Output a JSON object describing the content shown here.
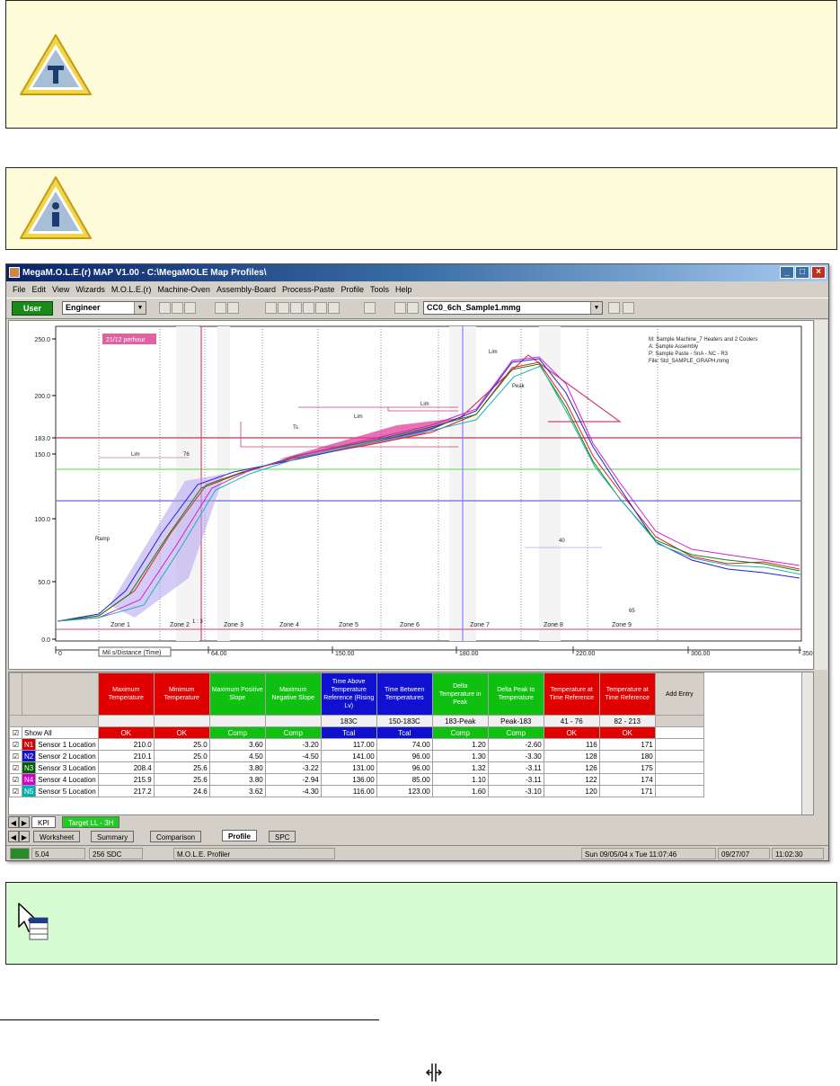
{
  "window": {
    "title": "MegaM.O.L.E.(r) MAP V1.00 - C:\\MegaMOLE Map Profiles\\",
    "menu": [
      "File",
      "Edit",
      "View",
      "Wizards",
      "M.O.L.E.(r)",
      "Machine-Oven",
      "Assembly-Board",
      "Process-Paste",
      "Profile",
      "Tools",
      "Help"
    ]
  },
  "toolbar": {
    "user_button": "User",
    "user_select": "Engineer",
    "profile_select": "CC0_6ch_Sample1.mmg"
  },
  "chart": {
    "badge": "21/12 perhour",
    "info_lines": [
      "M: Sample Machine_7 Heaters and 2 Coolers",
      "A: Sample Assembly",
      "P: Sample Paste - SnA - NC - R3",
      "File: Std_SAMPLE_GRAPH.mmg"
    ],
    "y_ticks": [
      "250.0",
      "200.0",
      "183.0",
      "150.0",
      "100.0",
      "50.0",
      "0.0"
    ],
    "x_axis_label": "Mil s/Distance (Time)",
    "x_ticks": [
      "0",
      "64.00",
      "150.00",
      "180.00",
      "220.00",
      "300.00",
      "350"
    ],
    "zones": [
      "Zone 1",
      "Zone 2",
      "Zone 3",
      "Zone 4",
      "Zone 5",
      "Zone 6",
      "Zone 7",
      "Zone 8",
      "Zone 9"
    ],
    "annotations": [
      "Ramp",
      "1 : 3",
      "Lim",
      "76",
      "Ts",
      "Lim",
      "Lim",
      "Lim",
      "Peak",
      "40",
      "65"
    ]
  },
  "grid": {
    "headers": [
      {
        "label": "Maximum Temperature",
        "color": "#e00000"
      },
      {
        "label": "Minimum Temperature",
        "color": "#e00000"
      },
      {
        "label": "Maximum Positive Slope",
        "color": "#10c010"
      },
      {
        "label": "Maximum Negative Slope",
        "color": "#10c010"
      },
      {
        "label": "Time Above Temperature Reference (Rising Lv)",
        "color": "#1010d0"
      },
      {
        "label": "Time Between Temperatures",
        "color": "#1010d0"
      },
      {
        "label": "Delta Temperature in Peak",
        "color": "#10c010"
      },
      {
        "label": "Delta Peak to Temperature",
        "color": "#10c010"
      },
      {
        "label": "Temperature at Time Reference",
        "color": "#e00000"
      },
      {
        "label": "Temperature at Time Reference",
        "color": "#e00000"
      }
    ],
    "add_entry": "Add Entry",
    "subheaders": [
      "",
      "",
      "",
      "",
      "183C",
      "150-183C",
      "183-Peak",
      "Peak-183",
      "41 - 76",
      "82 - 213"
    ],
    "show_all": "Show All",
    "status_row": [
      "OK",
      "OK",
      "Comp",
      "Comp",
      "Tcal",
      "Tcal",
      "Comp",
      "Comp",
      "OK",
      "OK"
    ],
    "rows": [
      {
        "tag": "N1",
        "tag_color": "#d00000",
        "label": "Sensor 1 Location",
        "values": [
          "210.0",
          "25.0",
          "3.60",
          "-3.20",
          "117.00",
          "74.00",
          "1.20",
          "-2.60",
          "116",
          "171"
        ]
      },
      {
        "tag": "N2",
        "tag_color": "#1010d0",
        "label": "Sensor 2 Location",
        "values": [
          "210.1",
          "25.0",
          "4.50",
          "-4.50",
          "141.00",
          "96.00",
          "1.30",
          "-3.30",
          "128",
          "180"
        ]
      },
      {
        "tag": "N3",
        "tag_color": "#006000",
        "label": "Sensor 3 Location",
        "values": [
          "208.4",
          "25.6",
          "3.80",
          "-3.22",
          "131.00",
          "96.00",
          "1.32",
          "-3.11",
          "126",
          "175"
        ]
      },
      {
        "tag": "N4",
        "tag_color": "#d000d0",
        "label": "Sensor 4 Location",
        "values": [
          "215.9",
          "25.6",
          "3.80",
          "-2.94",
          "136.00",
          "85.00",
          "1.10",
          "-3.11",
          "122",
          "174"
        ]
      },
      {
        "tag": "N5",
        "tag_color": "#00b0b0",
        "label": "Sensor 5 Location",
        "values": [
          "217.2",
          "24.6",
          "3.62",
          "-4.30",
          "116.00",
          "123.00",
          "1.60",
          "-3.10",
          "120",
          "171"
        ]
      }
    ]
  },
  "sheet_tabs": [
    "KPI",
    "Target LL - 3H"
  ],
  "bottom_tabs": [
    "Worksheet",
    "Summary",
    "Comparison",
    "Profile",
    "SPC"
  ],
  "status": [
    "5.04",
    "256 SDC",
    "M.O.L.E. Profiler",
    "Sun 09/05/04 x Tue 11:07:46",
    "09/27/07",
    "11:02:30"
  ],
  "colors": {
    "note_yellow": "#fefbd8",
    "note_green": "#d7fbd2",
    "triangle_fill": "#f2d64a",
    "triangle_inner": "#ffffff"
  },
  "icons": [
    "tip-triangle-icon",
    "info-triangle-icon",
    "cursor-table-icon",
    "splitter-icon"
  ]
}
